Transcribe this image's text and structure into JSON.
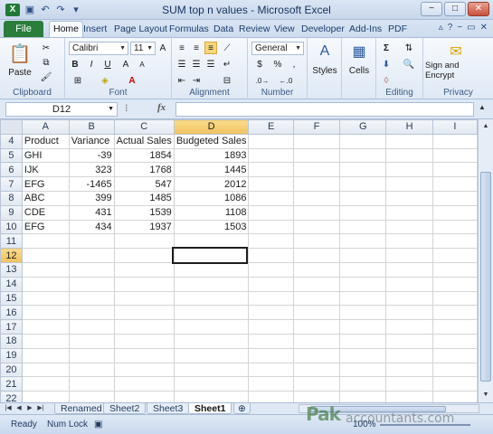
{
  "window": {
    "title": "SUM top n values - Microsoft Excel",
    "app_icon": "X",
    "min_label": "−",
    "max_label": "□",
    "close_label": "✕"
  },
  "ribbon_tabs": {
    "file": "File",
    "home": "Home",
    "insert": "Insert",
    "page_layout": "Page Layout",
    "formulas": "Formulas",
    "data": "Data",
    "review": "Review",
    "view": "View",
    "developer": "Developer",
    "addins": "Add-Ins",
    "pdf": "PDF"
  },
  "ribbon": {
    "clipboard": {
      "label": "Clipboard",
      "paste": "Paste"
    },
    "font": {
      "label": "Font",
      "font_name": "Calibri",
      "font_size": "11",
      "bold": "B",
      "italic": "I",
      "underline": "U"
    },
    "alignment": {
      "label": "Alignment"
    },
    "number": {
      "label": "Number",
      "format": "General",
      "currency": "$",
      "percent": "%",
      "comma": ","
    },
    "styles": {
      "label": "Styles"
    },
    "cells": {
      "label": "Cells"
    },
    "editing": {
      "label": "Editing",
      "autosum": "Σ"
    },
    "privacy": {
      "label": "Privacy",
      "sign_encrypt": "Sign and Encrypt"
    }
  },
  "formula_bar": {
    "name_box": "D12",
    "fx": "fx",
    "content": ""
  },
  "sheet": {
    "columns": [
      "A",
      "B",
      "C",
      "D",
      "E",
      "F",
      "G",
      "H",
      "I"
    ],
    "selected_column": "D",
    "selected_row": "12",
    "rows": [
      {
        "num": "4",
        "cells": [
          "Product",
          "Variance",
          "Actual Sales",
          "Budgeted Sales",
          "",
          "",
          "",
          "",
          ""
        ]
      },
      {
        "num": "5",
        "cells": [
          "GHI",
          "-39",
          "1854",
          "1893",
          "",
          "",
          "",
          "",
          ""
        ]
      },
      {
        "num": "6",
        "cells": [
          "IJK",
          "323",
          "1768",
          "1445",
          "",
          "",
          "",
          "",
          ""
        ]
      },
      {
        "num": "7",
        "cells": [
          "EFG",
          "-1465",
          "547",
          "2012",
          "",
          "",
          "",
          "",
          ""
        ]
      },
      {
        "num": "8",
        "cells": [
          "ABC",
          "399",
          "1485",
          "1086",
          "",
          "",
          "",
          "",
          ""
        ]
      },
      {
        "num": "9",
        "cells": [
          "CDE",
          "431",
          "1539",
          "1108",
          "",
          "",
          "",
          "",
          ""
        ]
      },
      {
        "num": "10",
        "cells": [
          "EFG",
          "434",
          "1937",
          "1503",
          "",
          "",
          "",
          "",
          ""
        ]
      },
      {
        "num": "11",
        "cells": [
          "",
          "",
          "",
          "",
          "",
          "",
          "",
          "",
          ""
        ]
      },
      {
        "num": "12",
        "cells": [
          "",
          "",
          "",
          "",
          "",
          "",
          "",
          "",
          ""
        ]
      },
      {
        "num": "13",
        "cells": [
          "",
          "",
          "",
          "",
          "",
          "",
          "",
          "",
          ""
        ]
      },
      {
        "num": "14",
        "cells": [
          "",
          "",
          "",
          "",
          "",
          "",
          "",
          "",
          ""
        ]
      },
      {
        "num": "15",
        "cells": [
          "",
          "",
          "",
          "",
          "",
          "",
          "",
          "",
          ""
        ]
      },
      {
        "num": "16",
        "cells": [
          "",
          "",
          "",
          "",
          "",
          "",
          "",
          "",
          ""
        ]
      },
      {
        "num": "17",
        "cells": [
          "",
          "",
          "",
          "",
          "",
          "",
          "",
          "",
          ""
        ]
      },
      {
        "num": "18",
        "cells": [
          "",
          "",
          "",
          "",
          "",
          "",
          "",
          "",
          ""
        ]
      },
      {
        "num": "19",
        "cells": [
          "",
          "",
          "",
          "",
          "",
          "",
          "",
          "",
          ""
        ]
      },
      {
        "num": "20",
        "cells": [
          "",
          "",
          "",
          "",
          "",
          "",
          "",
          "",
          ""
        ]
      },
      {
        "num": "21",
        "cells": [
          "",
          "",
          "",
          "",
          "",
          "",
          "",
          "",
          ""
        ]
      },
      {
        "num": "22",
        "cells": [
          "",
          "",
          "",
          "",
          "",
          "",
          "",
          "",
          ""
        ]
      }
    ]
  },
  "sheet_tabs": [
    "Renamed",
    "Sheet2",
    "Sheet3",
    "Sheet1"
  ],
  "active_sheet": "Sheet1",
  "status": {
    "ready": "Ready",
    "num_lock": "Num Lock",
    "zoom": "100%"
  },
  "watermark": {
    "brand": "Pak",
    "site": "accountants.com"
  },
  "colors": {
    "file_tab": "#2a7d3a",
    "selected_header": "#f1c15f",
    "ribbon_bg": "#dfe9f5"
  }
}
